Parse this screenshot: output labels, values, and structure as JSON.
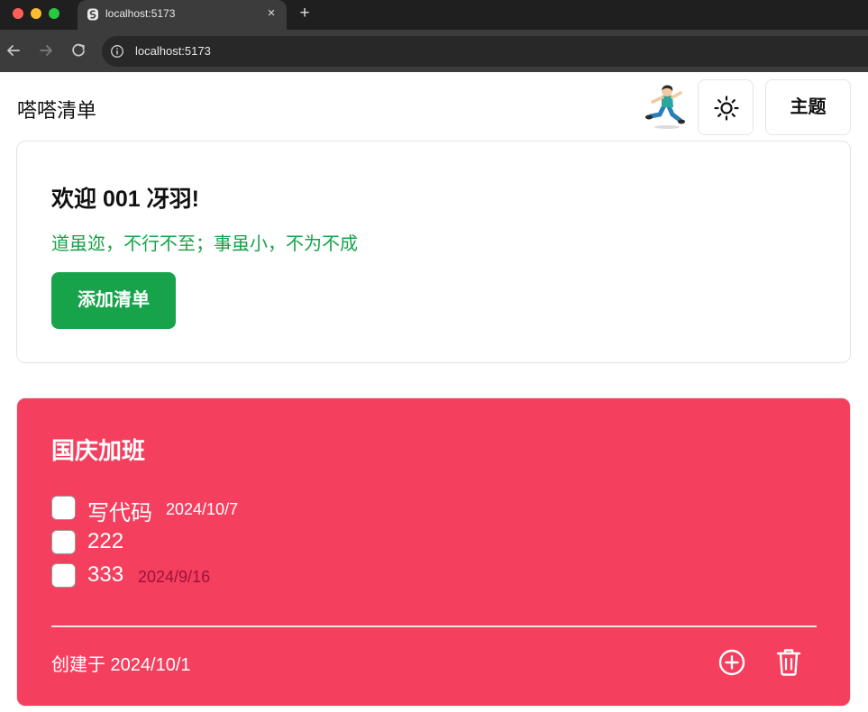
{
  "browser": {
    "tab_title": "localhost:5173",
    "tab_close": "×",
    "new_tab": "+",
    "url": "localhost:5173"
  },
  "header": {
    "app_title": "嗒嗒清单",
    "theme_button": "主题",
    "icons": [
      "sun-icon",
      "avatar-cartoon-running-boy"
    ]
  },
  "welcome": {
    "title": "欢迎 001 冴羽!",
    "motto": "道虽迩，不行不至；事虽小，不为不成",
    "add_list_button": "添加清单",
    "motto_color": "#16a34a",
    "button_color": "#16a34a"
  },
  "list": {
    "title": "国庆加班",
    "card_color": "#f43f5e",
    "items": [
      {
        "text": "写代码",
        "date": "2024/10/7",
        "date_color": "#ffffff",
        "checked": false
      },
      {
        "text": "222",
        "date": "",
        "checked": false
      },
      {
        "text": "333",
        "date": "2024/9/16",
        "date_color": "#9f1239",
        "checked": false
      }
    ],
    "created": "创建于 2024/10/1",
    "icons": [
      "plus-circle-icon",
      "trash-icon"
    ]
  }
}
